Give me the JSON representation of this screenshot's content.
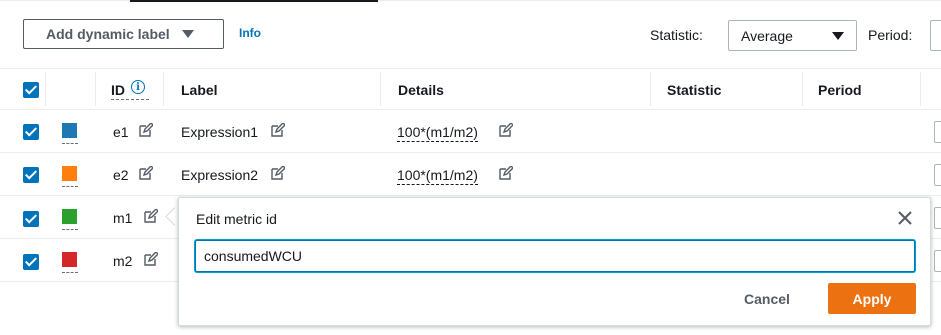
{
  "toolbar": {
    "add_dynamic_label": "Add dynamic label",
    "info_link": "Info",
    "statistic_label": "Statistic:",
    "statistic_value": "Average",
    "period_label": "Period:"
  },
  "table": {
    "headers": {
      "id": "ID",
      "label": "Label",
      "details": "Details",
      "statistic": "Statistic",
      "period": "Period"
    },
    "rows": [
      {
        "id": "e1",
        "label": "Expression1",
        "details": "100*(m1/m2)",
        "color": "#1f77b4",
        "checked": true
      },
      {
        "id": "e2",
        "label": "Expression2",
        "details": "100*(m1/m2)",
        "color": "#ff7f0e",
        "checked": true
      },
      {
        "id": "m1",
        "label": "",
        "details": "",
        "color": "#2ca02c",
        "checked": true
      },
      {
        "id": "m2",
        "label": "",
        "details": "",
        "color": "#d62728",
        "checked": true
      }
    ]
  },
  "popover": {
    "title": "Edit metric id",
    "input_value": "consumedWCU",
    "cancel_label": "Cancel",
    "apply_label": "Apply"
  },
  "colors": {
    "accent": "#0073bb",
    "apply_button": "#ec7211"
  }
}
